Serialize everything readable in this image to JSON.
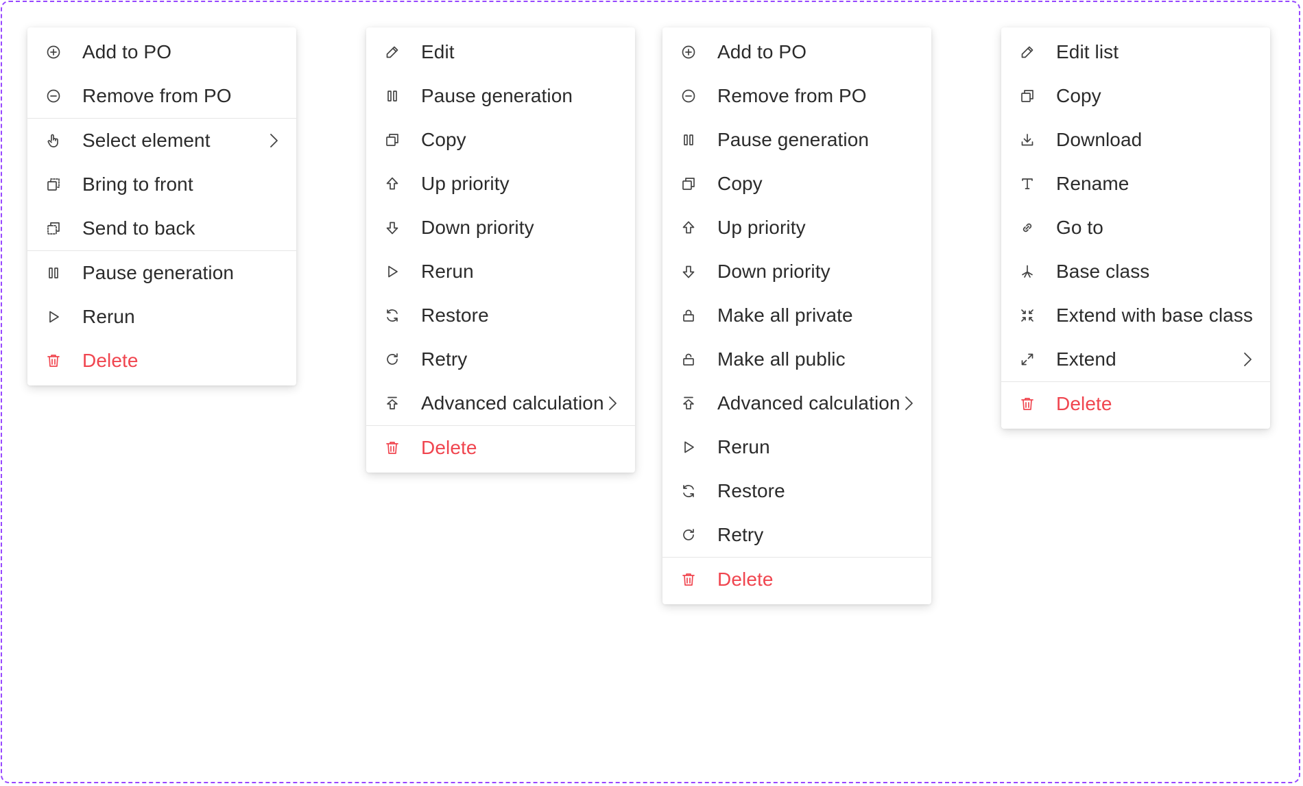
{
  "menus": [
    {
      "items": [
        {
          "label": "Add to PO",
          "icon": "plus-circle-icon"
        },
        {
          "label": "Remove from PO",
          "icon": "minus-circle-icon",
          "divider_after": true
        },
        {
          "label": "Select element",
          "icon": "pointer-hand-icon",
          "submenu": true
        },
        {
          "label": "Bring to front",
          "icon": "bring-to-front-icon"
        },
        {
          "label": "Send to back",
          "icon": "send-to-back-icon",
          "divider_after": true
        },
        {
          "label": "Pause generation",
          "icon": "pause-icon"
        },
        {
          "label": "Rerun",
          "icon": "play-icon"
        },
        {
          "label": "Delete",
          "icon": "trash-icon",
          "danger": true
        }
      ]
    },
    {
      "items": [
        {
          "label": "Edit",
          "icon": "pencil-icon"
        },
        {
          "label": "Pause generation",
          "icon": "pause-icon"
        },
        {
          "label": "Copy",
          "icon": "copy-icon"
        },
        {
          "label": "Up priority",
          "icon": "arrow-up-icon"
        },
        {
          "label": "Down priority",
          "icon": "arrow-down-icon"
        },
        {
          "label": "Rerun",
          "icon": "play-icon"
        },
        {
          "label": "Restore",
          "icon": "restore-icon"
        },
        {
          "label": "Retry",
          "icon": "retry-icon"
        },
        {
          "label": "Advanced calculation",
          "icon": "advanced-calc-icon",
          "submenu": true,
          "divider_after": true
        },
        {
          "label": "Delete",
          "icon": "trash-icon",
          "danger": true
        }
      ]
    },
    {
      "items": [
        {
          "label": "Add to PO",
          "icon": "plus-circle-icon"
        },
        {
          "label": "Remove from PO",
          "icon": "minus-circle-icon"
        },
        {
          "label": "Pause generation",
          "icon": "pause-icon"
        },
        {
          "label": "Copy",
          "icon": "copy-icon"
        },
        {
          "label": "Up priority",
          "icon": "arrow-up-icon"
        },
        {
          "label": "Down priority",
          "icon": "arrow-down-icon"
        },
        {
          "label": "Make all private",
          "icon": "lock-icon"
        },
        {
          "label": "Make all public",
          "icon": "unlock-icon"
        },
        {
          "label": "Advanced calculation",
          "icon": "advanced-calc-icon",
          "submenu": true
        },
        {
          "label": "Rerun",
          "icon": "play-icon"
        },
        {
          "label": "Restore",
          "icon": "restore-icon"
        },
        {
          "label": "Retry",
          "icon": "retry-icon",
          "divider_after": true
        },
        {
          "label": "Delete",
          "icon": "trash-icon",
          "danger": true
        }
      ]
    },
    {
      "items": [
        {
          "label": "Edit list",
          "icon": "pencil-icon"
        },
        {
          "label": "Copy",
          "icon": "copy-icon"
        },
        {
          "label": "Download",
          "icon": "download-icon"
        },
        {
          "label": "Rename",
          "icon": "text-icon"
        },
        {
          "label": "Go to",
          "icon": "link-icon"
        },
        {
          "label": "Base class",
          "icon": "asterisk-icon"
        },
        {
          "label": "Extend with base class",
          "icon": "collapse-arrows-icon"
        },
        {
          "label": "Extend",
          "icon": "expand-arrows-icon",
          "submenu": true,
          "divider_after": true
        },
        {
          "label": "Delete",
          "icon": "trash-icon",
          "danger": true
        }
      ]
    }
  ],
  "colors": {
    "frame": "#9747ff",
    "danger": "#f0454f",
    "text": "#2b2b2b"
  }
}
